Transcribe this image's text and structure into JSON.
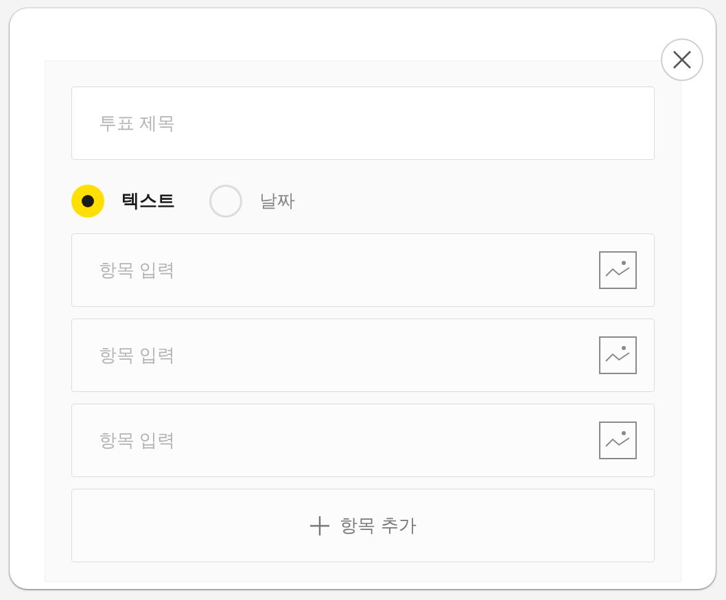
{
  "title_field": {
    "placeholder": "투표 제목"
  },
  "type_options": [
    {
      "label": "텍스트",
      "selected": true
    },
    {
      "label": "날짜",
      "selected": false
    }
  ],
  "items": [
    {
      "placeholder": "항목 입력"
    },
    {
      "placeholder": "항목 입력"
    },
    {
      "placeholder": "항목 입력"
    }
  ],
  "add_button": {
    "label": "항목 추가"
  }
}
